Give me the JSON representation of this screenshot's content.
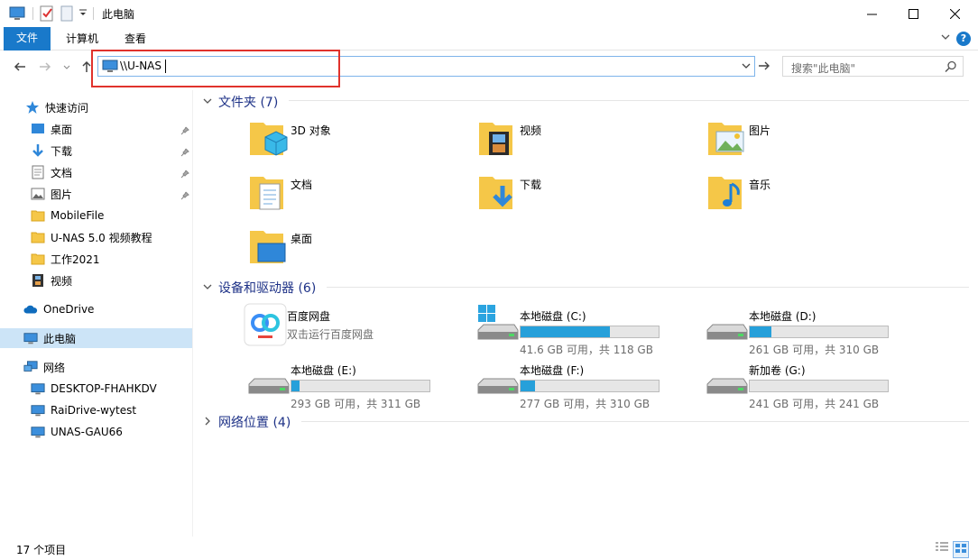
{
  "window": {
    "title": "此电脑",
    "minimize": "—",
    "maximize": "☐",
    "close": "✕"
  },
  "ribbon": {
    "tabs": [
      "文件",
      "计算机",
      "查看"
    ],
    "help": "?"
  },
  "address": {
    "value": "\\\\U-NAS",
    "search_placeholder": "搜索\"此电脑\""
  },
  "sidebar": {
    "quick_access": "快速访问",
    "quick_items": [
      "桌面",
      "下载",
      "文档",
      "图片",
      "MobileFile",
      "U-NAS 5.0 视频教程",
      "工作2021",
      "视频"
    ],
    "onedrive": "OneDrive",
    "this_pc": "此电脑",
    "network": "网络",
    "network_items": [
      "DESKTOP-FHAHKDV",
      "RaiDrive-wytest",
      "UNAS-GAU66"
    ]
  },
  "content": {
    "folders_header": "文件夹 (7)",
    "folders": [
      "3D 对象",
      "视频",
      "图片",
      "文档",
      "下载",
      "音乐",
      "桌面"
    ],
    "devices_header": "设备和驱动器 (6)",
    "baidu": {
      "name": "百度网盘",
      "sub": "双击运行百度网盘"
    },
    "drives": [
      {
        "name": "本地磁盘 (C:)",
        "info": "41.6 GB 可用，共 118 GB",
        "used": 0.647
      },
      {
        "name": "本地磁盘 (D:)",
        "info": "261 GB 可用，共 310 GB",
        "used": 0.158
      },
      {
        "name": "本地磁盘 (E:)",
        "info": "293 GB 可用，共 311 GB",
        "used": 0.058
      },
      {
        "name": "本地磁盘 (F:)",
        "info": "277 GB 可用，共 310 GB",
        "used": 0.106
      },
      {
        "name": "新加卷 (G:)",
        "info": "241 GB 可用，共 241 GB",
        "used": 0.0
      }
    ],
    "network_header": "网络位置 (4)"
  },
  "status": {
    "count": "17 个项目"
  },
  "colors": {
    "accent": "#1979ca",
    "folder": "#f5c748",
    "bar_fill": "#26a0da",
    "highlight": "#e0322c"
  }
}
